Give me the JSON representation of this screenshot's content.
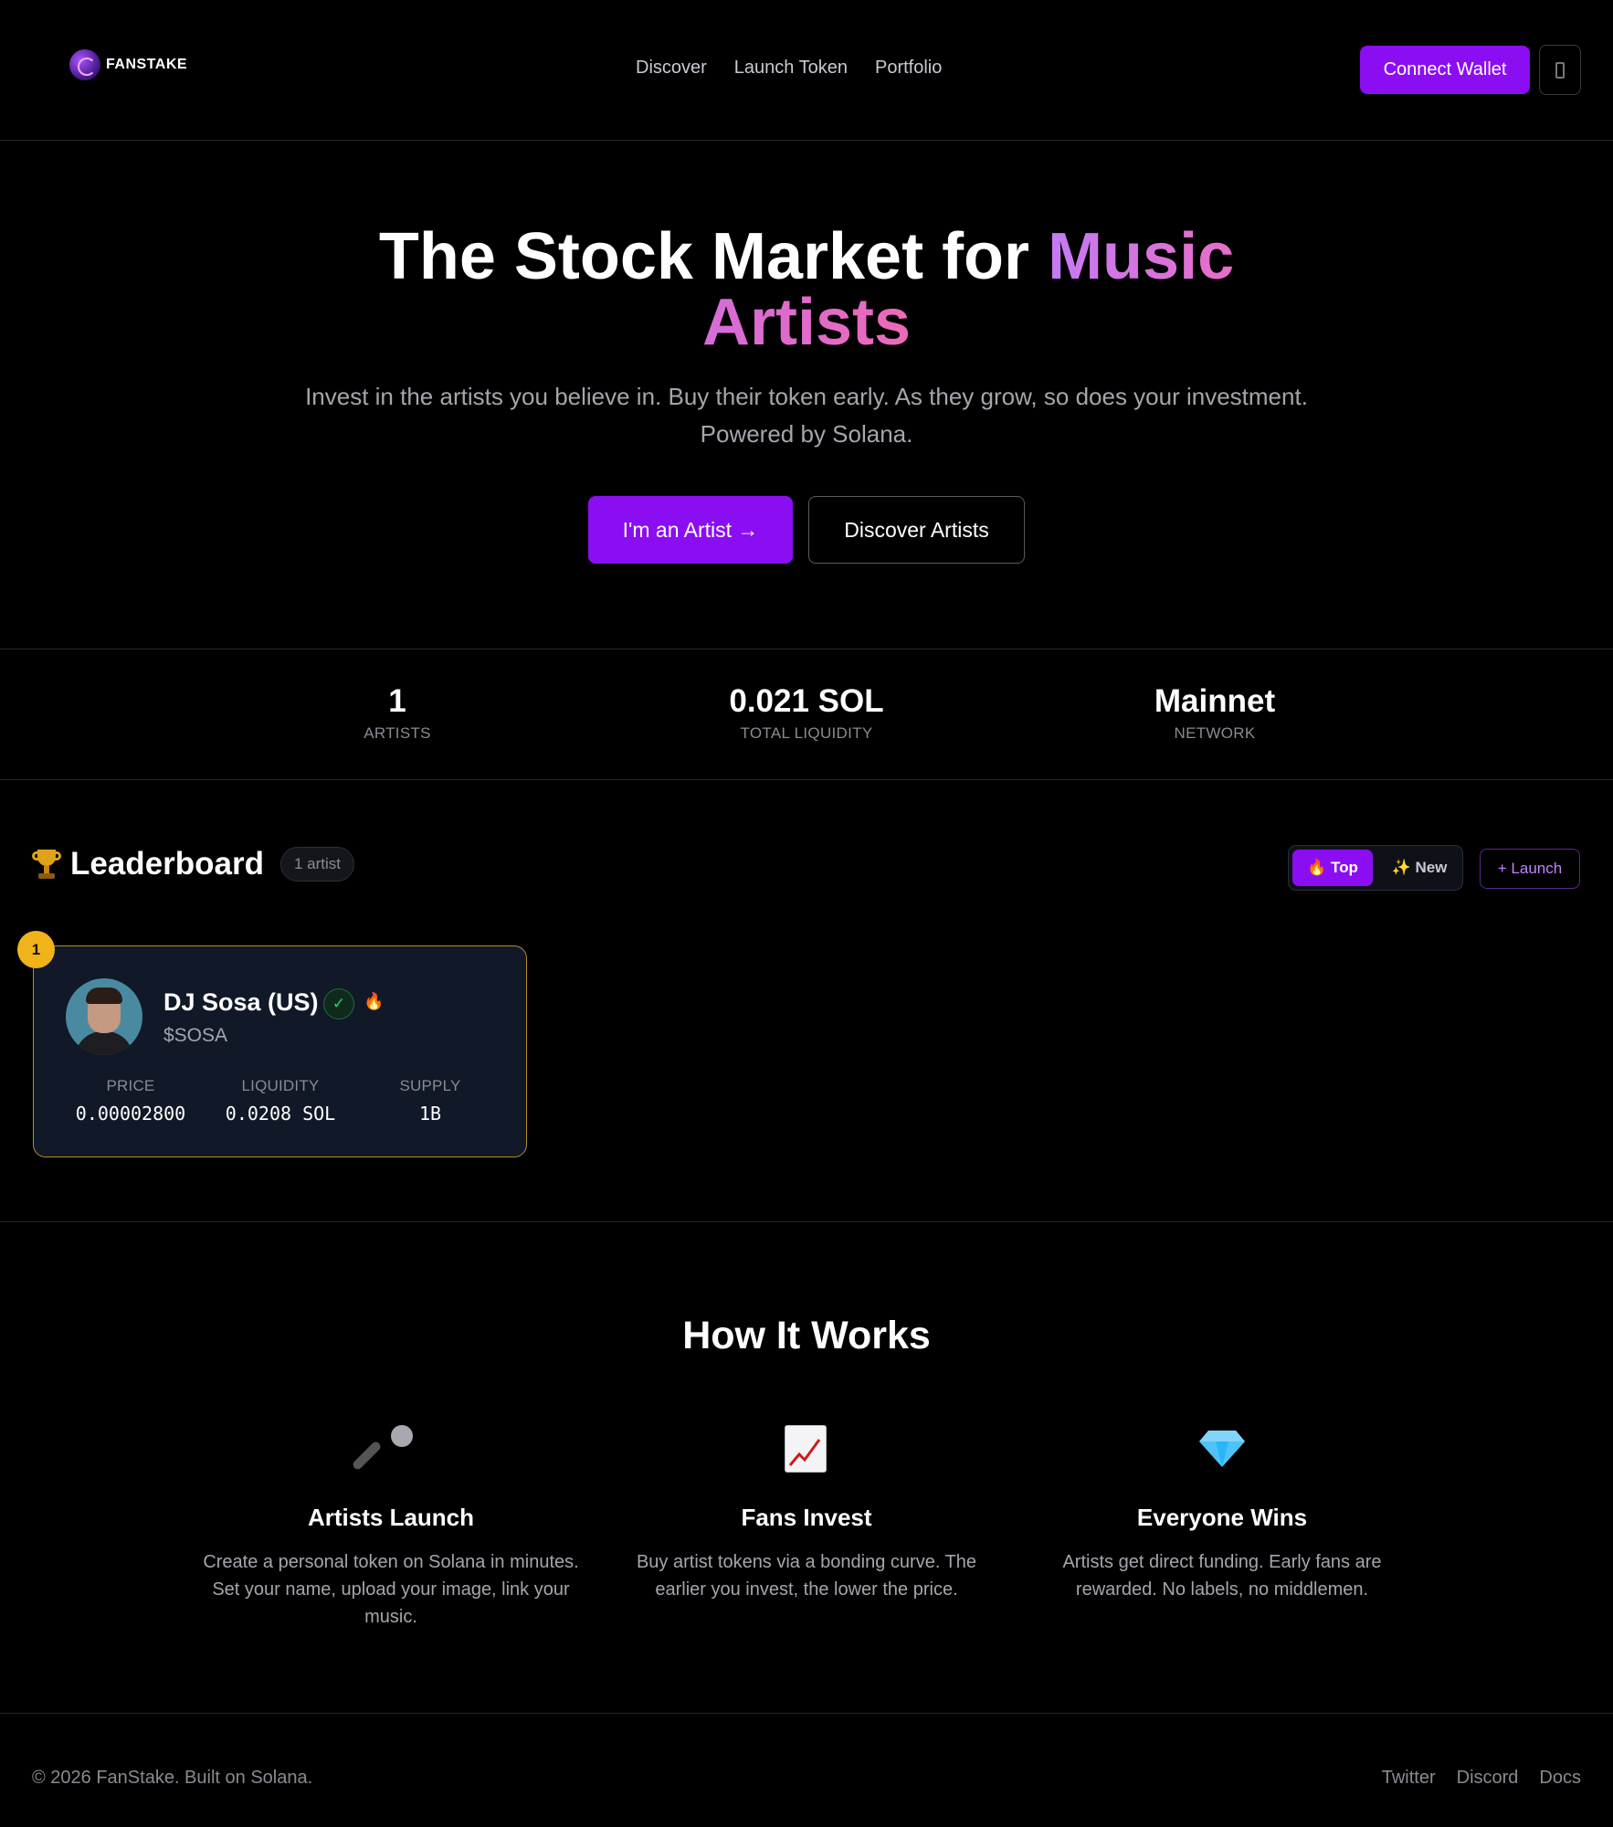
{
  "brand": {
    "name": "FANSTAKE"
  },
  "nav": {
    "items": [
      "Discover",
      "Launch Token",
      "Portfolio"
    ]
  },
  "header": {
    "connect_label": "Connect Wallet"
  },
  "hero": {
    "title_part1": "The Stock Market for ",
    "title_accent1": "Music",
    "title_accent2": "Artists",
    "subtitle_line1": "Invest in the artists you believe in. Buy their token early. As they grow, so does your investment.",
    "subtitle_line2": "Powered by Solana.",
    "artist_button": "I'm an Artist →",
    "discover_button": "Discover Artists"
  },
  "stats": [
    {
      "value": "1",
      "label": "ARTISTS"
    },
    {
      "value": "0.021 SOL",
      "label": "TOTAL LIQUIDITY"
    },
    {
      "value": "Mainnet",
      "label": "NETWORK"
    }
  ],
  "leaderboard": {
    "title": "Leaderboard",
    "count": "1 artist",
    "tab_top": "🔥 Top",
    "tab_new": "✨ New",
    "launch_button": "+ Launch",
    "cards": [
      {
        "rank": "1",
        "name": "DJ Sosa (US)",
        "verified": "✓",
        "hot": "🔥",
        "ticker": "$SOSA",
        "price_label": "PRICE",
        "price": "0.00002800",
        "liquidity_label": "LIQUIDITY",
        "liquidity": "0.0208 SOL",
        "supply_label": "SUPPLY",
        "supply": "1B"
      }
    ]
  },
  "how": {
    "title": "How It Works",
    "steps": [
      {
        "icon": "microphone-icon",
        "title": "Artists Launch",
        "desc": "Create a personal token on Solana in minutes. Set your name, upload your image, link your music."
      },
      {
        "icon": "chart-increasing-icon",
        "title": "Fans Invest",
        "desc": "Buy artist tokens via a bonding curve. The earlier you invest, the lower the price."
      },
      {
        "icon": "gem-icon",
        "title": "Everyone Wins",
        "desc": "Artists get direct funding. Early fans are rewarded. No labels, no middlemen."
      }
    ]
  },
  "footer": {
    "copyright": "© 2026 FanStake. Built on Solana.",
    "links": [
      "Twitter",
      "Discord",
      "Docs"
    ]
  },
  "colors": {
    "accent": "#8b0ef2",
    "gold": "#f0b41a",
    "card_bg": "#111827"
  }
}
